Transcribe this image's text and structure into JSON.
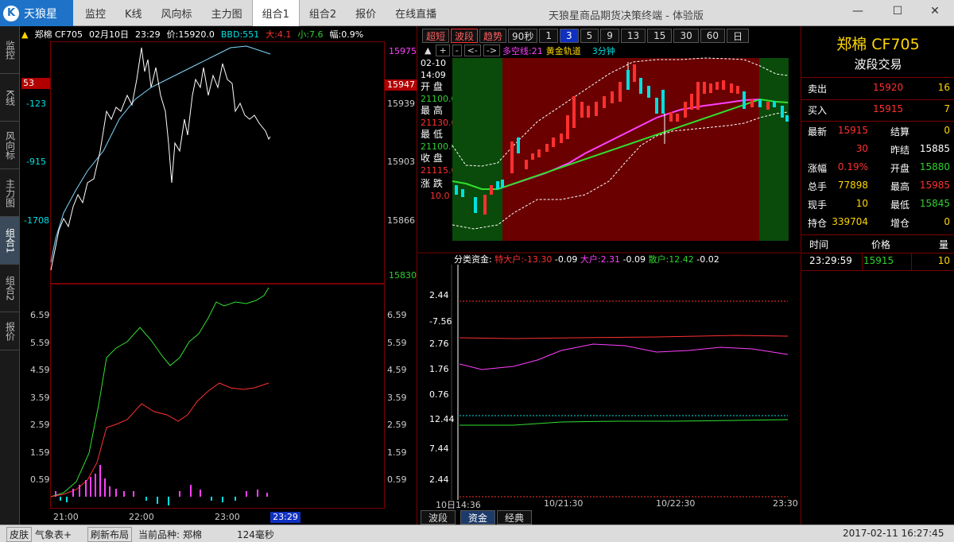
{
  "app": {
    "logo": "天狼星",
    "title": "天狼星商品期货决策终端 - 体验版"
  },
  "menu": [
    "监控",
    "K线",
    "风向标",
    "主力图",
    "组合1",
    "组合2",
    "报价",
    "在线直播"
  ],
  "menu_active": 4,
  "window": {
    "min": "—",
    "max": "☐",
    "close": "✕"
  },
  "left_tabs": [
    "监控",
    "K线",
    "风向标",
    "主力图",
    "组合1",
    "组合2",
    "报价"
  ],
  "tick": {
    "header": {
      "symbol": "郑棉 CF705",
      "date": "02月10日",
      "time": "23:29",
      "price": "价:15920.0",
      "bbd": "BBD:551",
      "big": "大:4.1",
      "small": "小:7.6",
      "amp": "幅:0.9%"
    },
    "left_axis": [
      "53",
      "-123",
      "-915",
      "-1708"
    ],
    "right_axis": [
      "15975",
      "15947",
      "15939",
      "15903",
      "15866",
      "15830"
    ],
    "lower_axis": [
      "6.59",
      "5.59",
      "4.59",
      "3.59",
      "2.59",
      "1.59",
      "0.59"
    ],
    "time_axis": [
      "21:00",
      "22:00",
      "23:00",
      "23:29"
    ]
  },
  "kline": {
    "buttons": [
      "超短",
      "波段",
      "趋势",
      "90秒"
    ],
    "periods": [
      "1",
      "3",
      "5",
      "9",
      "13",
      "15",
      "30",
      "60",
      "日"
    ],
    "period_active": "3",
    "nav": [
      "▲",
      "+",
      "-",
      "<-",
      "->"
    ],
    "legend": {
      "a": "多空线:21",
      "b": "黄金轨道",
      "c": "3分钟"
    },
    "info": {
      "date": "02-10",
      "time": "14:09",
      "open_lbl": "开 盘",
      "open": "21100.0",
      "high_lbl": "最 高",
      "high": "21130.0",
      "low_lbl": "最 低",
      "low": "21100.0",
      "close_lbl": "收 盘",
      "close": "21115.0",
      "chg_lbl": "涨 跌",
      "chg": "10.0"
    }
  },
  "fund": {
    "title": "分类资金:",
    "super": "特大户:-13.30",
    "super_d": "-0.09",
    "big": "大户:2.31",
    "big_d": "-0.09",
    "retail": "散户:12.42",
    "retail_d": "-0.02",
    "axis": [
      "2.44",
      "-7.56",
      "2.76",
      "1.76",
      "0.76",
      "12.44",
      "7.44",
      "2.44"
    ],
    "time_axis": [
      "10日14:36",
      "10/21:30",
      "10/22:30",
      "23:30"
    ]
  },
  "bottom_tabs": [
    "波段",
    "资金",
    "经典"
  ],
  "bottom_active": 1,
  "right": {
    "name": "郑棉 CF705",
    "mode": "波段交易",
    "sell": {
      "label": "卖出",
      "price": "15920",
      "vol": "16"
    },
    "buy": {
      "label": "买入",
      "price": "15915",
      "vol": "7"
    },
    "stats": [
      {
        "l1": "最新",
        "v1": "15915",
        "l2": "结算",
        "v2": "0"
      },
      {
        "l1": "",
        "v1": "30",
        "l2": "昨结",
        "v2": "15885"
      },
      {
        "l1": "涨幅",
        "v1": "0.19%",
        "l2": "开盘",
        "v2": "15880"
      },
      {
        "l1": "总手",
        "v1": "77898",
        "l2": "最高",
        "v2": "15985"
      },
      {
        "l1": "现手",
        "v1": "10",
        "l2": "最低",
        "v2": "15845"
      },
      {
        "l1": "持仓",
        "v1": "339704",
        "l2": "增仓",
        "v2": "0"
      }
    ],
    "trade_head": {
      "time": "时间",
      "price": "价格",
      "vol": "量"
    },
    "trades": [
      {
        "time": "23:29:59",
        "price": "15915",
        "vol": "10"
      }
    ]
  },
  "status": {
    "skin": "皮肤",
    "weather": "气象表+",
    "refresh": "刷新布局",
    "current": "当前品种: 郑棉",
    "latency": "124毫秒",
    "datetime": "2017-02-11 16:27:45"
  }
}
